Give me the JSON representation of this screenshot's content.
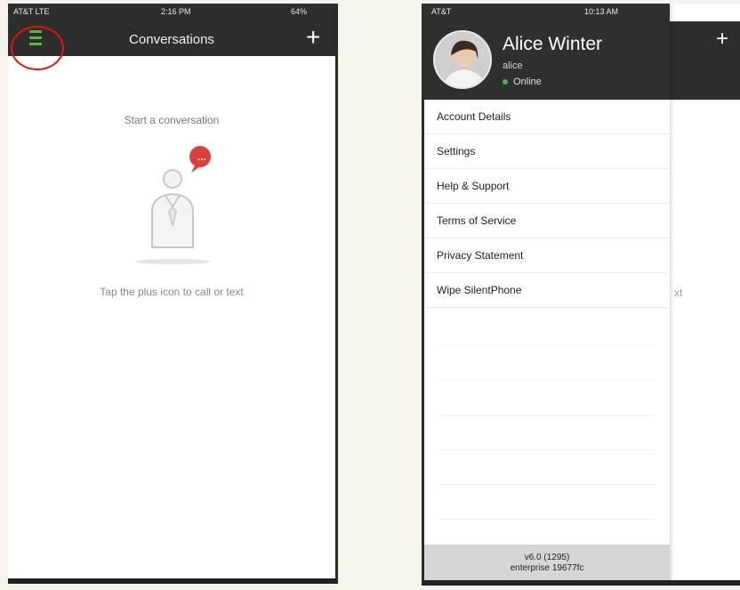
{
  "left_screen": {
    "status": {
      "carrier": "AT&T LTE",
      "time": "2:16 PM",
      "battery": "64%"
    },
    "title": "Conversations",
    "add_label": "+",
    "empty_title": "Start a conversation",
    "empty_hint": "Tap the plus icon to call or text",
    "bubble_text": "..."
  },
  "right_screen": {
    "status": {
      "carrier": "AT&T",
      "time": "10:13 AM"
    },
    "profile": {
      "name": "Alice Winter",
      "username": "alice",
      "presence": "Online"
    },
    "menu_items": [
      {
        "label": "Account Details"
      },
      {
        "label": "Settings"
      },
      {
        "label": "Help & Support"
      },
      {
        "label": "Terms of Service"
      },
      {
        "label": "Privacy Statement"
      },
      {
        "label": "Wipe SilentPhone"
      }
    ],
    "footer": {
      "version": "v6.0 (1295)",
      "build": "enterprise 19677fc"
    },
    "add_label": "+",
    "peek_text": "xt"
  },
  "colors": {
    "nav": "#2d2d2d",
    "accent_green": "#5fb04a",
    "badge_red": "#d9403a",
    "highlight_red": "#e01414"
  }
}
